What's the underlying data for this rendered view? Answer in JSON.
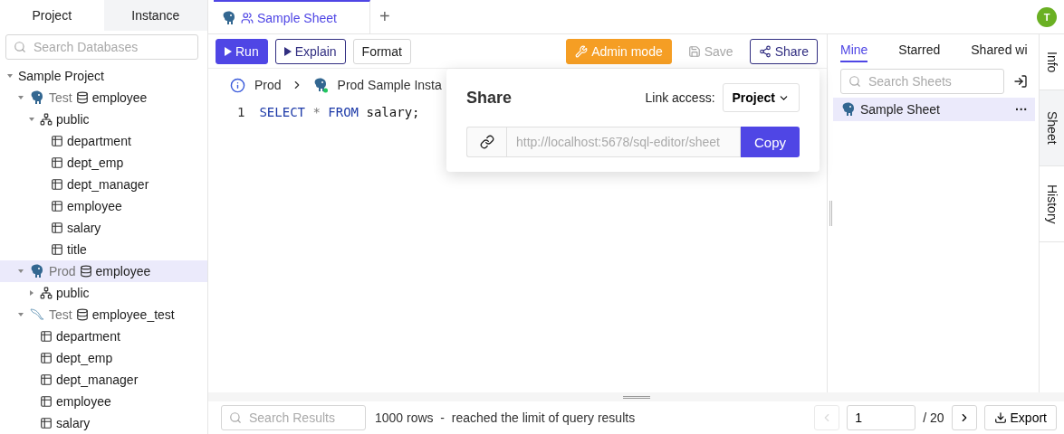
{
  "sidebar": {
    "tabs": [
      {
        "label": "Project",
        "selected": true
      },
      {
        "label": "Instance",
        "selected": false
      }
    ],
    "search": {
      "placeholder": "Search Databases"
    },
    "tree": [
      {
        "kind": "project",
        "label": "Sample Project",
        "expanded": true,
        "children": [
          {
            "kind": "postgres",
            "env": "Test",
            "label": "employee",
            "expanded": true,
            "selected": false,
            "children": [
              {
                "kind": "schema",
                "label": "public",
                "expanded": true,
                "children": [
                  {
                    "kind": "table",
                    "label": "department"
                  },
                  {
                    "kind": "table",
                    "label": "dept_emp"
                  },
                  {
                    "kind": "table",
                    "label": "dept_manager"
                  },
                  {
                    "kind": "table",
                    "label": "employee"
                  },
                  {
                    "kind": "table",
                    "label": "salary"
                  },
                  {
                    "kind": "table",
                    "label": "title"
                  }
                ]
              }
            ]
          },
          {
            "kind": "postgres",
            "env": "Prod",
            "label": "employee",
            "expanded": true,
            "selected": true,
            "children": [
              {
                "kind": "schema",
                "label": "public",
                "expanded": false
              }
            ]
          },
          {
            "kind": "mysql",
            "env": "Test",
            "label": "employee_test",
            "expanded": true,
            "selected": false,
            "children": [
              {
                "kind": "table",
                "label": "department"
              },
              {
                "kind": "table",
                "label": "dept_emp"
              },
              {
                "kind": "table",
                "label": "dept_manager"
              },
              {
                "kind": "table",
                "label": "employee"
              },
              {
                "kind": "table",
                "label": "salary"
              }
            ]
          }
        ]
      }
    ]
  },
  "editor": {
    "tabs": [
      {
        "label": "Sample Sheet",
        "selected": true
      }
    ],
    "add_tab": "+",
    "avatar": "T",
    "toolbar": [
      {
        "kind": "primary",
        "label": "Run",
        "disabled": false
      },
      {
        "kind": "outline",
        "label": "Explain",
        "disabled": false
      },
      {
        "kind": "default",
        "label": "Format",
        "disabled": false
      },
      {
        "kind": "warning",
        "label": "Admin mode",
        "disabled": false
      },
      {
        "kind": "plain",
        "label": "Save",
        "disabled": true
      },
      {
        "kind": "outline",
        "label": "Share",
        "disabled": false
      }
    ],
    "breadcrumb": {
      "environment": "Prod",
      "instance": "Prod Sample Insta"
    },
    "code_lines": [
      {
        "number": "1",
        "tokens": [
          {
            "text": "SELECT",
            "kind": "keyword"
          },
          {
            "text": "*",
            "kind": "operator"
          },
          {
            "text": "FROM",
            "kind": "keyword"
          },
          {
            "text": "salary;",
            "kind": "plain"
          }
        ]
      }
    ]
  },
  "share_popover": {
    "title": "Share",
    "access_label": "Link access:",
    "access": "Project",
    "url": "http://localhost:5678/sql-editor/sheet",
    "copy": "Copy"
  },
  "sheets_panel": {
    "tabs": [
      {
        "label": "Mine",
        "selected": true
      },
      {
        "label": "Starred",
        "selected": false
      },
      {
        "label": "Shared wi",
        "selected": false
      }
    ],
    "search": {
      "placeholder": "Search Sheets"
    },
    "sheets": [
      {
        "name": "Sample Sheet",
        "selected": true,
        "menu": "···"
      }
    ]
  },
  "side_tabs": [
    {
      "label": "Info",
      "selected": false
    },
    {
      "label": "Sheet",
      "selected": true
    },
    {
      "label": "History",
      "selected": false
    }
  ],
  "results_bar": {
    "search": {
      "placeholder": "Search Results"
    },
    "summary": "1000 rows  -  reached the limit of query results",
    "page": "1",
    "total": "/ 20",
    "export": "Export"
  }
}
